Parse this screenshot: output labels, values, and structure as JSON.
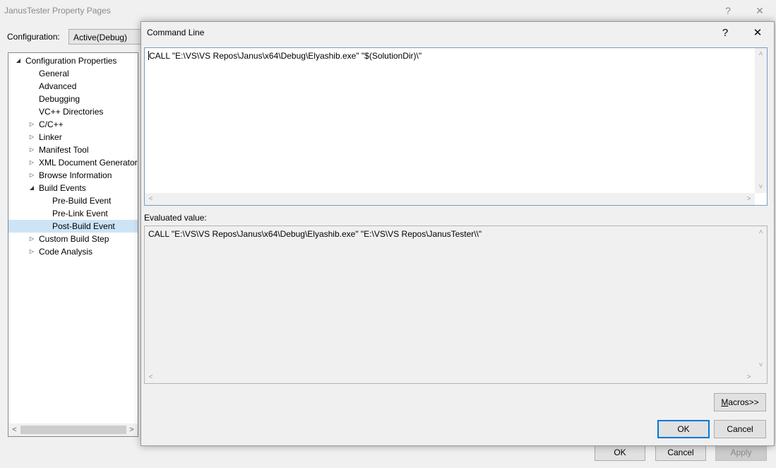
{
  "parent": {
    "title": "JanusTester Property Pages",
    "help_glyph": "?",
    "close_glyph": "✕",
    "config_label": "Configuration:",
    "config_value": "Active(Debug)",
    "tree": [
      {
        "label": "Configuration Properties",
        "twisty": "◢",
        "indent": 0
      },
      {
        "label": "General",
        "twisty": "",
        "indent": 1
      },
      {
        "label": "Advanced",
        "twisty": "",
        "indent": 1
      },
      {
        "label": "Debugging",
        "twisty": "",
        "indent": 1
      },
      {
        "label": "VC++ Directories",
        "twisty": "",
        "indent": 1
      },
      {
        "label": "C/C++",
        "twisty": "▷",
        "indent": 1
      },
      {
        "label": "Linker",
        "twisty": "▷",
        "indent": 1
      },
      {
        "label": "Manifest Tool",
        "twisty": "▷",
        "indent": 1
      },
      {
        "label": "XML Document Generator",
        "twisty": "▷",
        "indent": 1
      },
      {
        "label": "Browse Information",
        "twisty": "▷",
        "indent": 1
      },
      {
        "label": "Build Events",
        "twisty": "◢",
        "indent": 1
      },
      {
        "label": "Pre-Build Event",
        "twisty": "",
        "indent": 2
      },
      {
        "label": "Pre-Link Event",
        "twisty": "",
        "indent": 2
      },
      {
        "label": "Post-Build Event",
        "twisty": "",
        "indent": 2,
        "selected": true
      },
      {
        "label": "Custom Build Step",
        "twisty": "▷",
        "indent": 1
      },
      {
        "label": "Code Analysis",
        "twisty": "▷",
        "indent": 1
      }
    ],
    "scroll_left": "<",
    "scroll_right": ">",
    "buttons": {
      "ok": "OK",
      "cancel": "Cancel",
      "apply": "Apply"
    }
  },
  "dialog": {
    "title": "Command Line",
    "help_glyph": "?",
    "close_glyph": "✕",
    "command_text": "CALL \"E:\\VS\\VS Repos\\Janus\\x64\\Debug\\Elyashib.exe\" \"$(SolutionDir)\\\"",
    "evaluated_label": "Evaluated value:",
    "evaluated_text": "CALL \"E:\\VS\\VS Repos\\Janus\\x64\\Debug\\Elyashib.exe\" \"E:\\VS\\VS Repos\\JanusTester\\\\\"",
    "scroll_up": "˄",
    "scroll_down": "˅",
    "scroll_left": "<",
    "scroll_right": ">",
    "macros_mnemonic": "M",
    "macros_rest": "acros>>",
    "ok": "OK",
    "cancel": "Cancel"
  }
}
